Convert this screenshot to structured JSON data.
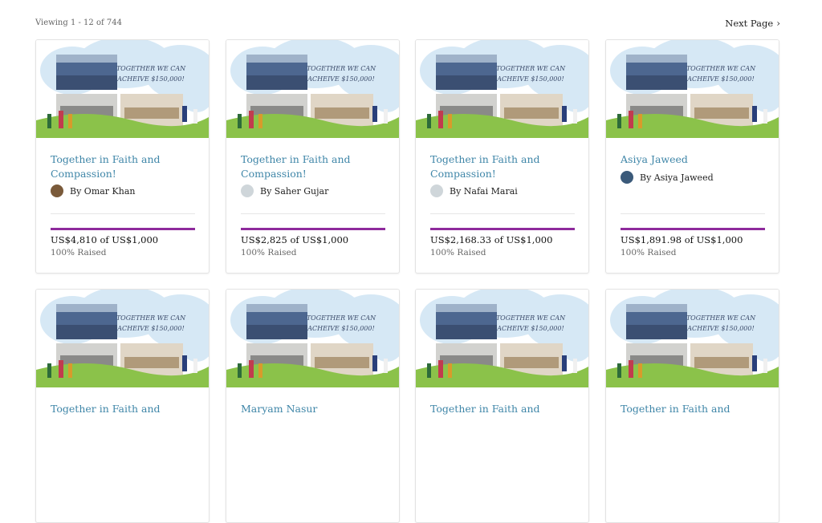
{
  "pagination": {
    "viewing": "Viewing 1 - 12 of 744",
    "next_label": "Next Page"
  },
  "banner": {
    "line1": "TOGETHER WE CAN",
    "line2": "ACHEIVE $150,000!"
  },
  "cards": [
    {
      "title": "Together in Faith and Compassion!",
      "author": "By Omar Khan",
      "amount": "US$4,810 of US$1,000",
      "raised_label": "100% Raised",
      "raised_fraction": 1.0
    },
    {
      "title": "Together in Faith and Compassion!",
      "author": "By Saher Gujar",
      "amount": "US$2,825 of US$1,000",
      "raised_label": "100% Raised",
      "raised_fraction": 1.0
    },
    {
      "title": "Together in Faith and Compassion!",
      "author": "By Nafai Marai",
      "amount": "US$2,168.33 of US$1,000",
      "raised_label": "100% Raised",
      "raised_fraction": 1.0
    },
    {
      "title": "Asiya Jaweed",
      "author": "By Asiya Jaweed",
      "amount": "US$1,891.98 of US$1,000",
      "raised_label": "100% Raised",
      "raised_fraction": 1.0
    },
    {
      "title": "Together in Faith and"
    },
    {
      "title": "Maryam Nasur"
    },
    {
      "title": "Together in Faith and"
    },
    {
      "title": "Together in Faith and"
    }
  ],
  "colors": {
    "title": "#3f86a8",
    "progress": "#8e2a9c"
  }
}
